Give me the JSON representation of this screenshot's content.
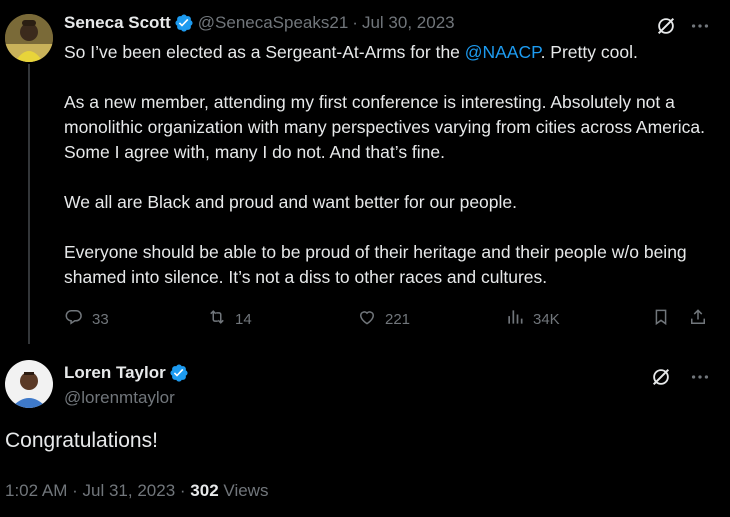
{
  "tweet1": {
    "author_name": "Seneca Scott",
    "handle": "@SenecaSpeaks21",
    "separator": "·",
    "date": "Jul 30, 2023",
    "text_before_mention": "So I’ve been elected as a Sergeant-At-Arms for the ",
    "mention": "@NAACP",
    "text_after_mention": ".  Pretty cool.",
    "para2": "As a new member, attending my first conference is interesting. Absolutely not a monolithic organization with many perspectives varying from cities across America.  Some I agree with, many I do not. And that’s fine.",
    "para3": "We all are Black and proud and want better for our people.",
    "para4": "Everyone should be able to be proud of their heritage and their people w/o being shamed into silence. It’s not a diss to other races and cultures.",
    "replies": "33",
    "retweets": "14",
    "likes": "221",
    "views": "34K"
  },
  "tweet2": {
    "author_name": "Loren Taylor",
    "handle": "@lorenmtaylor",
    "text": "Congratulations!",
    "time": "1:02 AM",
    "sep1": "·",
    "date": "Jul 31, 2023",
    "sep2": "·",
    "views_count": "302",
    "views_label": "Views"
  },
  "icons": [
    "grok-icon",
    "more-icon",
    "verified-icon",
    "reply-icon",
    "retweet-icon",
    "like-icon",
    "views-icon",
    "bookmark-icon",
    "share-icon"
  ],
  "colors": {
    "background": "#000000",
    "text": "#e7e9ea",
    "secondary": "#71767b",
    "accent": "#1d9bf0"
  }
}
